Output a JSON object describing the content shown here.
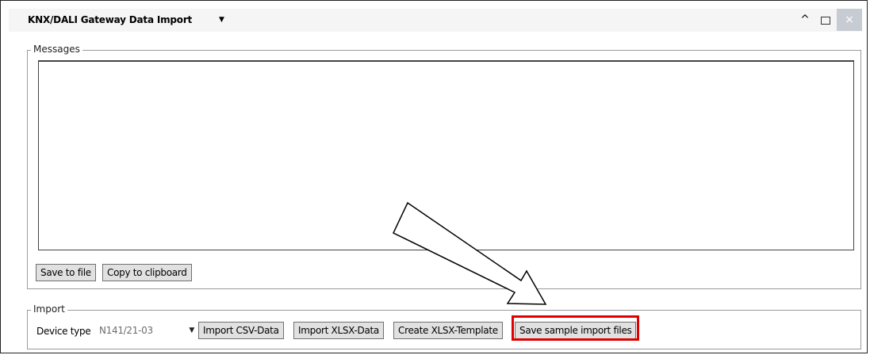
{
  "window": {
    "title": "KNX/DALI Gateway Data Import",
    "dropdown_icon": "▼",
    "collapse_icon": "^",
    "close_icon": "×"
  },
  "messages": {
    "group_label": "Messages",
    "content": "",
    "save_to_file": "Save to file",
    "copy_to_clipboard": "Copy to clipboard"
  },
  "import": {
    "group_label": "Import",
    "device_type_label": "Device type",
    "device_type_value": "N141/21-03",
    "device_caret": "▼",
    "import_csv": "Import CSV-Data",
    "import_xlsx": "Import XLSX-Data",
    "create_template": "Create XLSX-Template",
    "save_samples": "Save sample import files"
  },
  "annotation": {
    "arrow_color": "#000000",
    "highlight_color": "#e00000"
  }
}
